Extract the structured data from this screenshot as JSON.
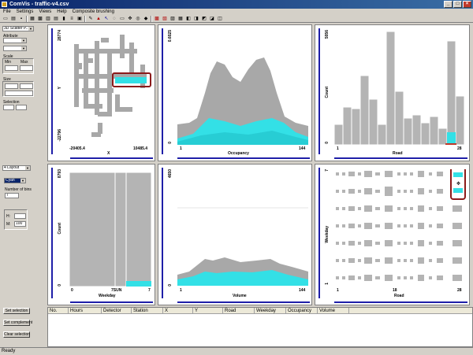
{
  "window": {
    "title": "ComVis - traffic-v4.csv"
  },
  "menu": [
    "File",
    "Settings",
    "Views",
    "Help",
    "Composite brushing"
  ],
  "controls": {
    "color_select": "Cyan",
    "top_select": "3D Scatter P..",
    "bottom_select": "4 Layout",
    "attribute_label": "Attribute",
    "scale_label": "Scale",
    "size_label": "Size",
    "min_label": "Min",
    "max_label": "Max",
    "selection_label": "Selection",
    "number_label": "Number of bins",
    "number_value": "7",
    "h_label": "H:",
    "m_label": "M:",
    "m_value": "100"
  },
  "views": {
    "scatter": {
      "xlabel": "X",
      "ylabel": "Y",
      "xmin": "-20405.4",
      "xmax": "10485.4",
      "ymin": "-22796",
      "ymax": "28774"
    },
    "occupancy": {
      "xlabel": "Occupancy",
      "ymin": "0",
      "ymax": "0.6025",
      "xmin": "1",
      "xmax": "144"
    },
    "road": {
      "xlabel": "Road",
      "ylabel": "Count",
      "xmin": "1",
      "xmax": "28",
      "ymax": "5056",
      "ymin": "0"
    },
    "weekday": {
      "xlabel": "Weekday",
      "ylabel": "Count",
      "xmin": "0",
      "xmid": "7SUN",
      "xmax": "7",
      "ymax": "8793",
      "ymin": "0"
    },
    "volume": {
      "xlabel": "Volume",
      "ymin": "0",
      "ymax": "4650",
      "xmin": "1",
      "xmax": "144"
    },
    "weekday_road": {
      "xlabel": "Road",
      "ylabel": "Weekday",
      "xmin": "1",
      "xmid": "18",
      "xmax": "28",
      "ymin": "1",
      "ymax": "7"
    }
  },
  "side_buttons": [
    "Set selection",
    "Set complement",
    "Clear selection"
  ],
  "table": {
    "columns": [
      "No.",
      "Hours",
      "Detector",
      "Station",
      "X",
      "Y",
      "Road",
      "Weekday",
      "Occupancy",
      "Volume"
    ]
  },
  "status": "Ready",
  "colors": {
    "accent": "#1f1fa8",
    "highlight": "#33e0e6",
    "bar": "#b4b4b4",
    "frame": "#8b1a1a"
  }
}
